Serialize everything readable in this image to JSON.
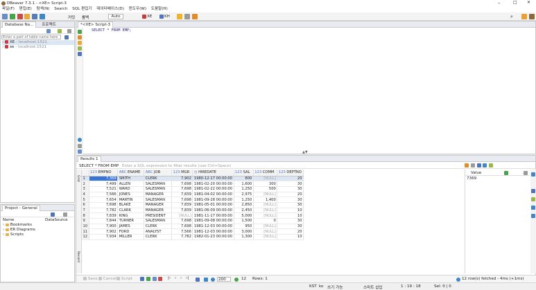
{
  "window": {
    "title": "DBeaver 7.3.1 - <XE> Script-3"
  },
  "menu": [
    "파일(F)",
    "편집(E)",
    "탐색(N)",
    "Search",
    "SQL 편집기",
    "데이터베이스(D)",
    "윈도우(W)",
    "도움말(H)"
  ],
  "toolbar": {
    "commit": "커밋",
    "rollback": "롤백",
    "mode": "Auto",
    "connection": "XE",
    "schema": "KH"
  },
  "db_navigator": {
    "tab_label": "Database Na...",
    "tab2_label": "프로젝트",
    "filter_placeholder": "Enter a part of table name here",
    "connections": [
      {
        "name": "XE",
        "host": " - localhost:1521"
      },
      {
        "name": "xe",
        "host": " - localhost:1521"
      }
    ]
  },
  "editor": {
    "tab_label": "*<XE> Script-3",
    "sql": "SELECT * FROM EMP;"
  },
  "project": {
    "tab_label": "Project - General",
    "col_name": "Name",
    "col_source": "DataSource",
    "items": [
      "Bookmarks",
      "ER Diagrams",
      "Scripts"
    ]
  },
  "results": {
    "tab_label": "Results 1",
    "query_label": "SELECT * FROM EMP",
    "filter_placeholder": "Enter a SQL expression to filter results (use Ctrl+Space)",
    "side_label": "Grid",
    "columns": [
      {
        "name": "EMPNO",
        "type": "123"
      },
      {
        "name": "ENAME",
        "type": "ABC"
      },
      {
        "name": "JOB",
        "type": "ABC"
      },
      {
        "name": "MGR",
        "type": "123"
      },
      {
        "name": "HIREDATE",
        "type": "clock"
      },
      {
        "name": "SAL",
        "type": "123"
      },
      {
        "name": "COMM",
        "type": "123"
      },
      {
        "name": "DEPTNO",
        "type": "123"
      }
    ],
    "rows": [
      [
        "7,369",
        "SMITH",
        "CLERK",
        "7,902",
        "1980-12-17 00:00:00",
        "800",
        "[NULL]",
        "20"
      ],
      [
        "7,499",
        "ALLEN",
        "SALESMAN",
        "7,698",
        "1981-02-20 00:00:00",
        "1,600",
        "300",
        "30"
      ],
      [
        "7,521",
        "WARD",
        "SALESMAN",
        "7,698",
        "1981-02-22 00:00:00",
        "1,250",
        "500",
        "30"
      ],
      [
        "7,566",
        "JONES",
        "MANAGER",
        "7,839",
        "1981-04-02 00:00:00",
        "2,975",
        "[NULL]",
        "20"
      ],
      [
        "7,654",
        "MARTIN",
        "SALESMAN",
        "7,698",
        "1981-09-28 00:00:00",
        "1,250",
        "1,400",
        "30"
      ],
      [
        "7,698",
        "BLAKE",
        "MANAGER",
        "7,839",
        "1981-05-01 00:00:00",
        "2,850",
        "[NULL]",
        "30"
      ],
      [
        "7,782",
        "CLARK",
        "MANAGER",
        "7,839",
        "1981-06-09 00:00:00",
        "2,450",
        "[NULL]",
        "10"
      ],
      [
        "7,839",
        "KING",
        "PRESIDENT",
        "[NULL]",
        "1981-11-17 00:00:00",
        "5,000",
        "[NULL]",
        "10"
      ],
      [
        "7,844",
        "TURNER",
        "SALESMAN",
        "7,698",
        "1981-09-08 00:00:00",
        "1,500",
        "0",
        "30"
      ],
      [
        "7,900",
        "JAMES",
        "CLERK",
        "7,698",
        "1981-12-03 00:00:00",
        "950",
        "[NULL]",
        "30"
      ],
      [
        "7,902",
        "FORD",
        "ANALYST",
        "7,566",
        "1981-12-03 00:00:00",
        "3,000",
        "[NULL]",
        "20"
      ],
      [
        "7,934",
        "MILLER",
        "CLERK",
        "7,782",
        "1982-01-23 00:00:00",
        "1,300",
        "[NULL]",
        "10"
      ]
    ],
    "value_panel": {
      "label": "Value",
      "value": "7369"
    },
    "bottom": {
      "save": "Save",
      "cancel": "Cancel",
      "script": "Script",
      "fetch_size": "200",
      "row_count": "12",
      "rows_label": "Rows: 1",
      "fetched": "12 row(s) fetched - 4ms (+1ms)",
      "record_label": "Record"
    }
  },
  "status": {
    "tz": "KST",
    "lang": "ko",
    "write": "쓰기 가능",
    "insert": "스마트 삽입",
    "pos": "1 : 19 : 18",
    "sel": "Sel: 0 | 0"
  }
}
